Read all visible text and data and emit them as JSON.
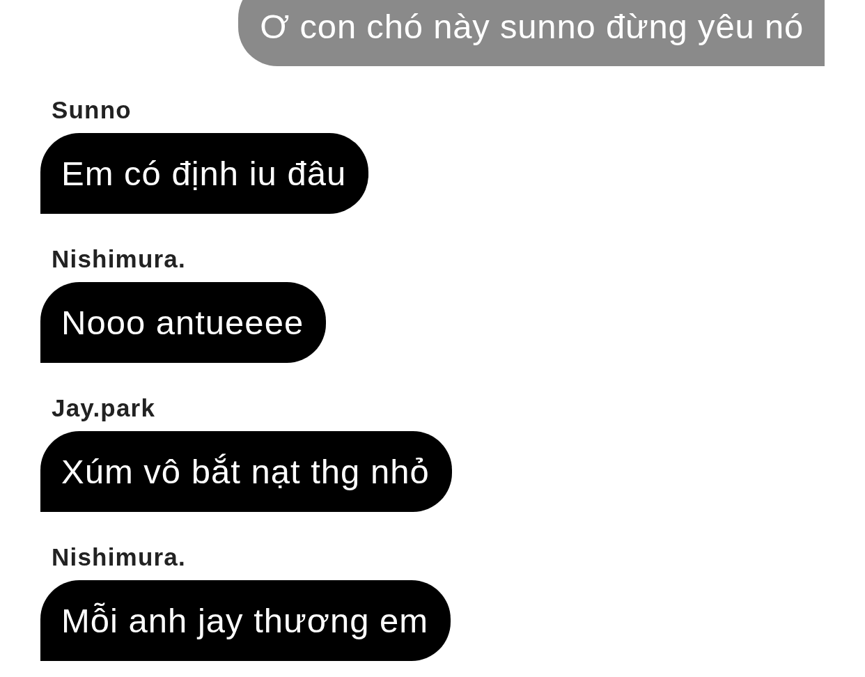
{
  "messages": [
    {
      "kind": "sent",
      "text": "Ơ con chó này sunno đừng yêu nó"
    },
    {
      "kind": "received",
      "sender": "Sunno",
      "text": "Em có định iu đâu"
    },
    {
      "kind": "received",
      "sender": "Nishimura.",
      "text": "Nooo antueeee"
    },
    {
      "kind": "received",
      "sender": "Jay.park",
      "text": "Xúm vô bắt nạt thg nhỏ"
    },
    {
      "kind": "received",
      "sender": "Nishimura.",
      "text": "Mỗi anh jay thương em"
    }
  ]
}
